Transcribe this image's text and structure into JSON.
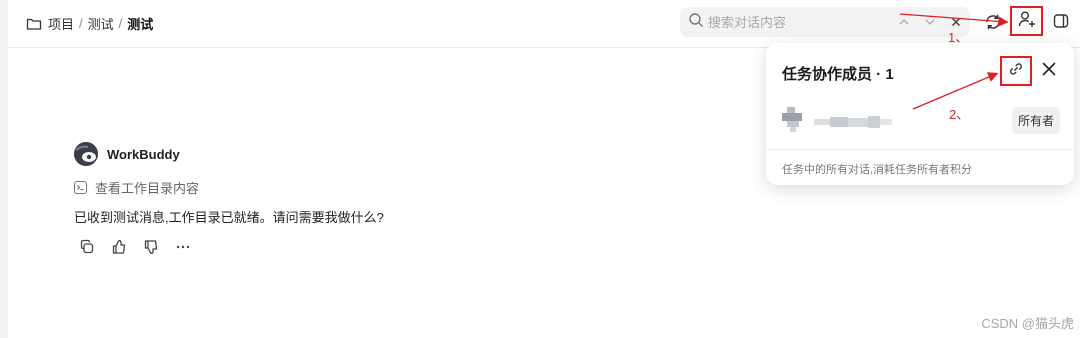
{
  "breadcrumb": {
    "items": [
      "项目",
      "测试"
    ],
    "separator": "/",
    "current": "测试"
  },
  "search": {
    "placeholder": "搜索对话内容"
  },
  "annotations": {
    "label_1": "1、",
    "label_2": "2、",
    "color": "#e02020"
  },
  "chat": {
    "bot_name": "WorkBuddy",
    "tool_action": "查看工作目录内容",
    "message": "已收到测试消息,工作目录已就绪。请问需要我做什么?"
  },
  "popup": {
    "title": "任务协作成员 · 1",
    "owner_badge": "所有者",
    "footer": "任务中的所有对话,消耗任务所有者积分"
  },
  "watermark": "CSDN @猫头虎",
  "icons": {
    "breadcrumb": "folder-icon",
    "search": "search-icon",
    "search_prev": "chevron-up-icon",
    "search_next": "chevron-down-icon",
    "search_clear": "close-icon",
    "sync": "sync-icon",
    "add_member": "add-user-icon",
    "panel": "panel-toggle-icon",
    "link": "link-icon",
    "close": "close-icon"
  }
}
